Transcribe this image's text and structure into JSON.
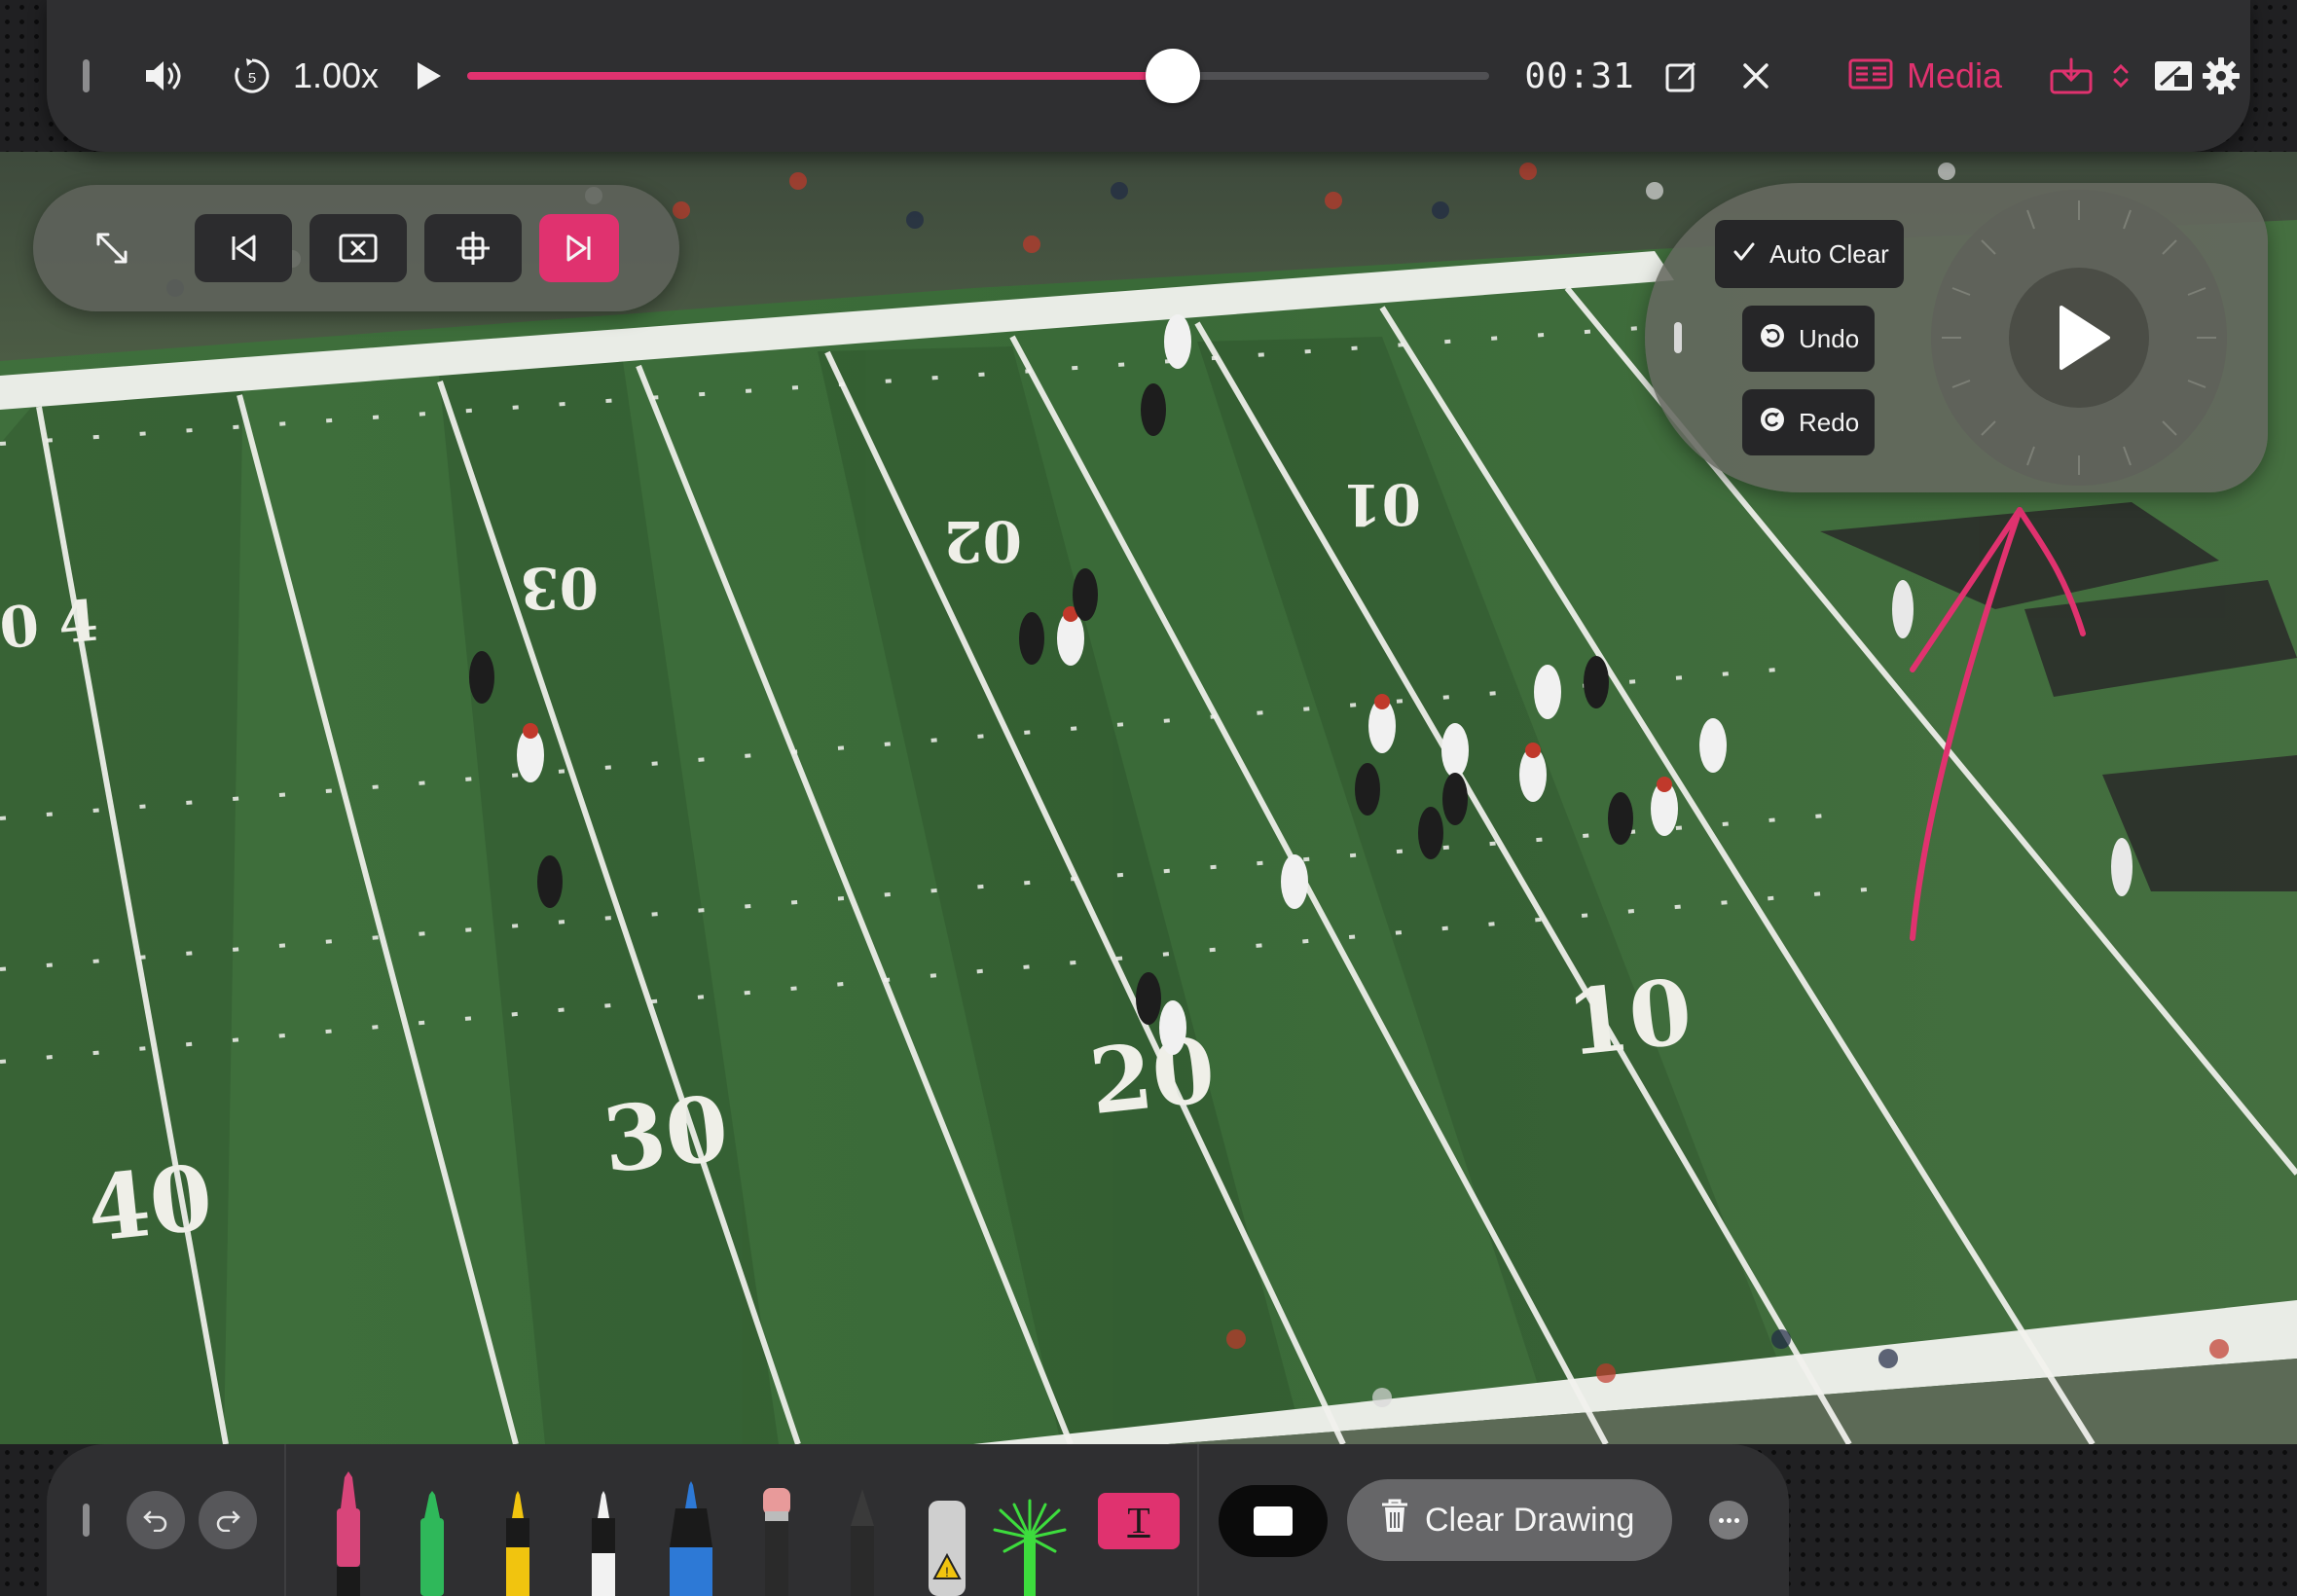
{
  "player": {
    "speed": "1.00x",
    "timecode": "00:31",
    "progress_fraction": 0.69,
    "media_label": "Media",
    "accent_color": "#e0326f",
    "icons": [
      "drag-handle-icon",
      "volume-icon",
      "replay-5-icon",
      "play-icon",
      "edit-icon",
      "close-icon",
      "media-icon",
      "download-icon",
      "chevron-updown-icon",
      "picture-in-picture-icon",
      "gear-icon"
    ]
  },
  "floating_toolbar": {
    "icons": [
      "expand-icon",
      "skip-back-icon",
      "clear-frame-icon",
      "crosshair-icon",
      "skip-forward-icon"
    ],
    "active": "skip-forward-icon"
  },
  "drawing_panel": {
    "auto_clear": "Auto Clear",
    "auto_clear_checked": true,
    "undo": "Undo",
    "redo": "Redo",
    "dial_icon": "play-icon"
  },
  "field": {
    "yard_numbers_far": [
      "0",
      "4",
      "30",
      "20",
      "10"
    ],
    "yard_numbers_near": [
      "40",
      "30",
      "20",
      "10"
    ]
  },
  "drawing_tools": {
    "pens": [
      {
        "name": "pink-marker",
        "color": "#d8457a"
      },
      {
        "name": "green-marker",
        "color": "#2fb85a"
      },
      {
        "name": "yellow-marker",
        "color": "#f1c40f"
      },
      {
        "name": "white-marker",
        "color": "#f2f2f2"
      },
      {
        "name": "blue-marker",
        "color": "#2d79d6"
      },
      {
        "name": "eraser",
        "color": "#e89a9a"
      },
      {
        "name": "pencil",
        "color": "#555555"
      },
      {
        "name": "highlighter",
        "color": "#cfcfcf"
      },
      {
        "name": "spray",
        "color": "#3ddc3d"
      }
    ],
    "text_tool_label": "T",
    "clear_drawing": "Clear Drawing"
  }
}
